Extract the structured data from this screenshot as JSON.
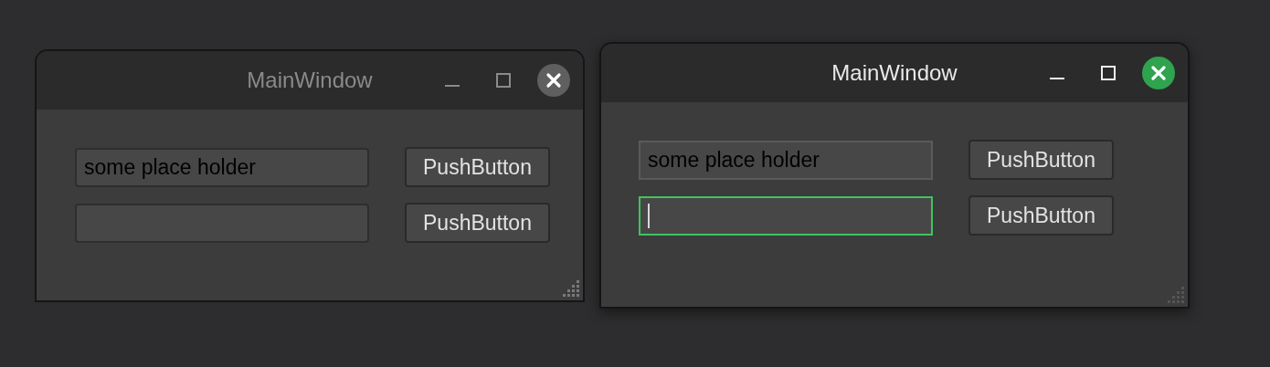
{
  "windows": [
    {
      "title": "MainWindow",
      "active": false,
      "rows": [
        {
          "field": {
            "placeholder": "some place holder",
            "focused": false
          },
          "button": "PushButton"
        },
        {
          "field": {
            "focused": false
          },
          "button": "PushButton"
        }
      ]
    },
    {
      "title": "MainWindow",
      "active": true,
      "rows": [
        {
          "field": {
            "placeholder": "some place holder",
            "focused": false
          },
          "button": "PushButton"
        },
        {
          "field": {
            "focused": true
          },
          "button": "PushButton"
        }
      ]
    }
  ]
}
